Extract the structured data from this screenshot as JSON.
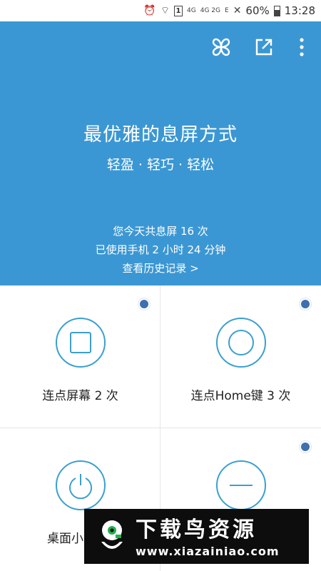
{
  "status_bar": {
    "sim_slot": "1",
    "network_4g": "4G",
    "network_4g_2g": "4G 2G",
    "network_e": "E",
    "battery": "60%",
    "time": "13:28"
  },
  "toolbar": {
    "icons": [
      "apps-icon",
      "share-icon",
      "more-icon"
    ]
  },
  "hero": {
    "title": "最优雅的息屏方式",
    "subtitle": "轻盈 · 轻巧 · 轻松"
  },
  "stats": {
    "line1": "您今天共息屏 16 次",
    "line2": "已使用手机 2 小时 24 分钟",
    "history_link": "查看历史记录 >"
  },
  "options": [
    {
      "label": "连点屏幕 2 次",
      "icon": "square-icon",
      "selected": true
    },
    {
      "label": "连点Home键 3 次",
      "icon": "circle-icon",
      "selected": true
    },
    {
      "label": "桌面小",
      "icon": "power-icon",
      "selected": false
    },
    {
      "label": "",
      "icon": "minus-icon",
      "selected": true
    }
  ],
  "watermark": {
    "title": "下载鸟资源",
    "url": "www.xiazainiao.com"
  },
  "colors": {
    "header_bg": "#3b97d3",
    "icon_stroke": "#3aa0cf",
    "radio_dot": "#3f6fae"
  }
}
